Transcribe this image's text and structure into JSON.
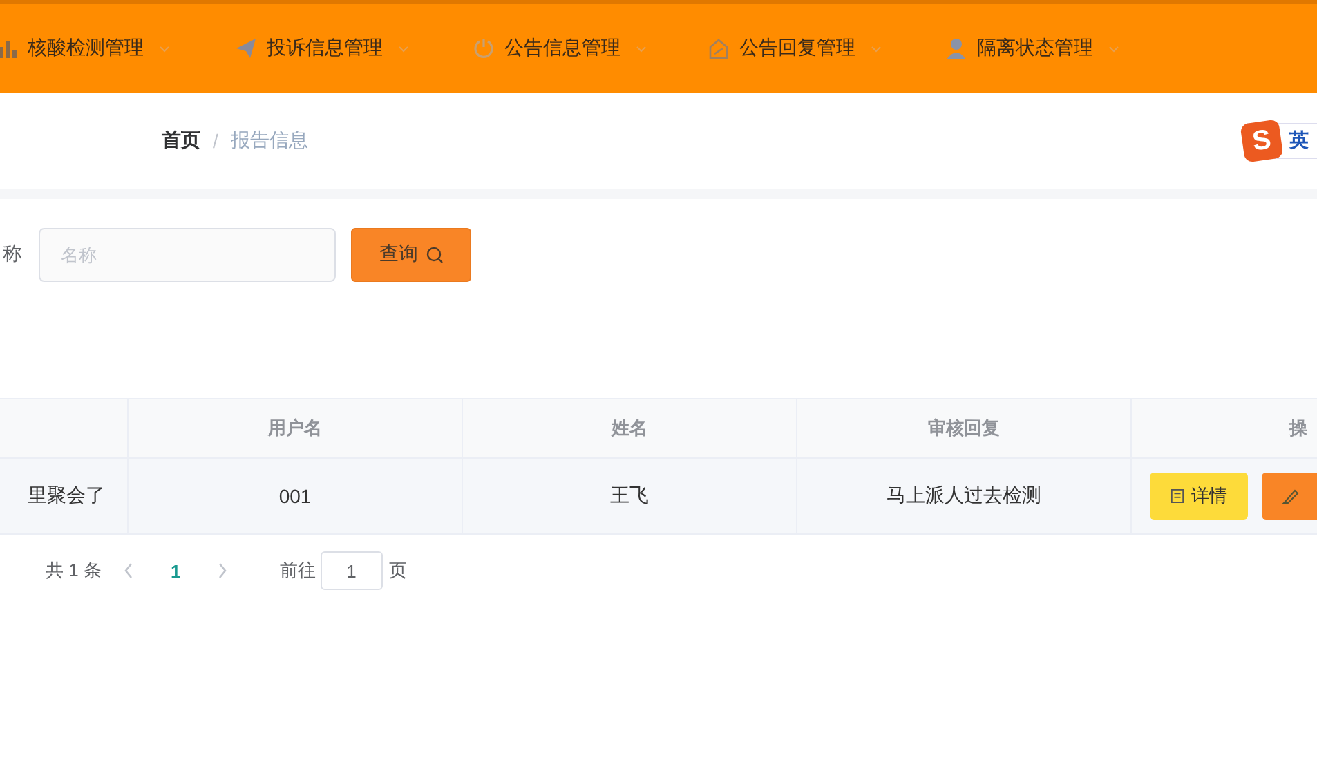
{
  "nav": {
    "items": [
      {
        "label": "核酸检测管理"
      },
      {
        "label": "投诉信息管理"
      },
      {
        "label": "公告信息管理"
      },
      {
        "label": "公告回复管理"
      },
      {
        "label": "隔离状态管理"
      }
    ]
  },
  "breadcrumb": {
    "separator": "/",
    "items": [
      {
        "label": "首页",
        "current": false
      },
      {
        "label": "报告信息",
        "current": true
      }
    ]
  },
  "ime": {
    "logo": "S",
    "mode": "英"
  },
  "search": {
    "label": "称",
    "placeholder": "名称",
    "button": "查询"
  },
  "table": {
    "columns": [
      "",
      "用户名",
      "姓名",
      "审核回复",
      "操"
    ],
    "rows": [
      {
        "cells": [
          "里聚会了",
          "001",
          "王飞",
          "马上派人过去检测"
        ],
        "actions": [
          {
            "kind": "detail",
            "label": "详情"
          },
          {
            "kind": "edit"
          }
        ]
      }
    ]
  },
  "pager": {
    "total": "共 1 条",
    "pages": [
      {
        "label": "1",
        "selected": true
      }
    ],
    "goto": "前往",
    "page_value": "1",
    "suffix": "页"
  }
}
